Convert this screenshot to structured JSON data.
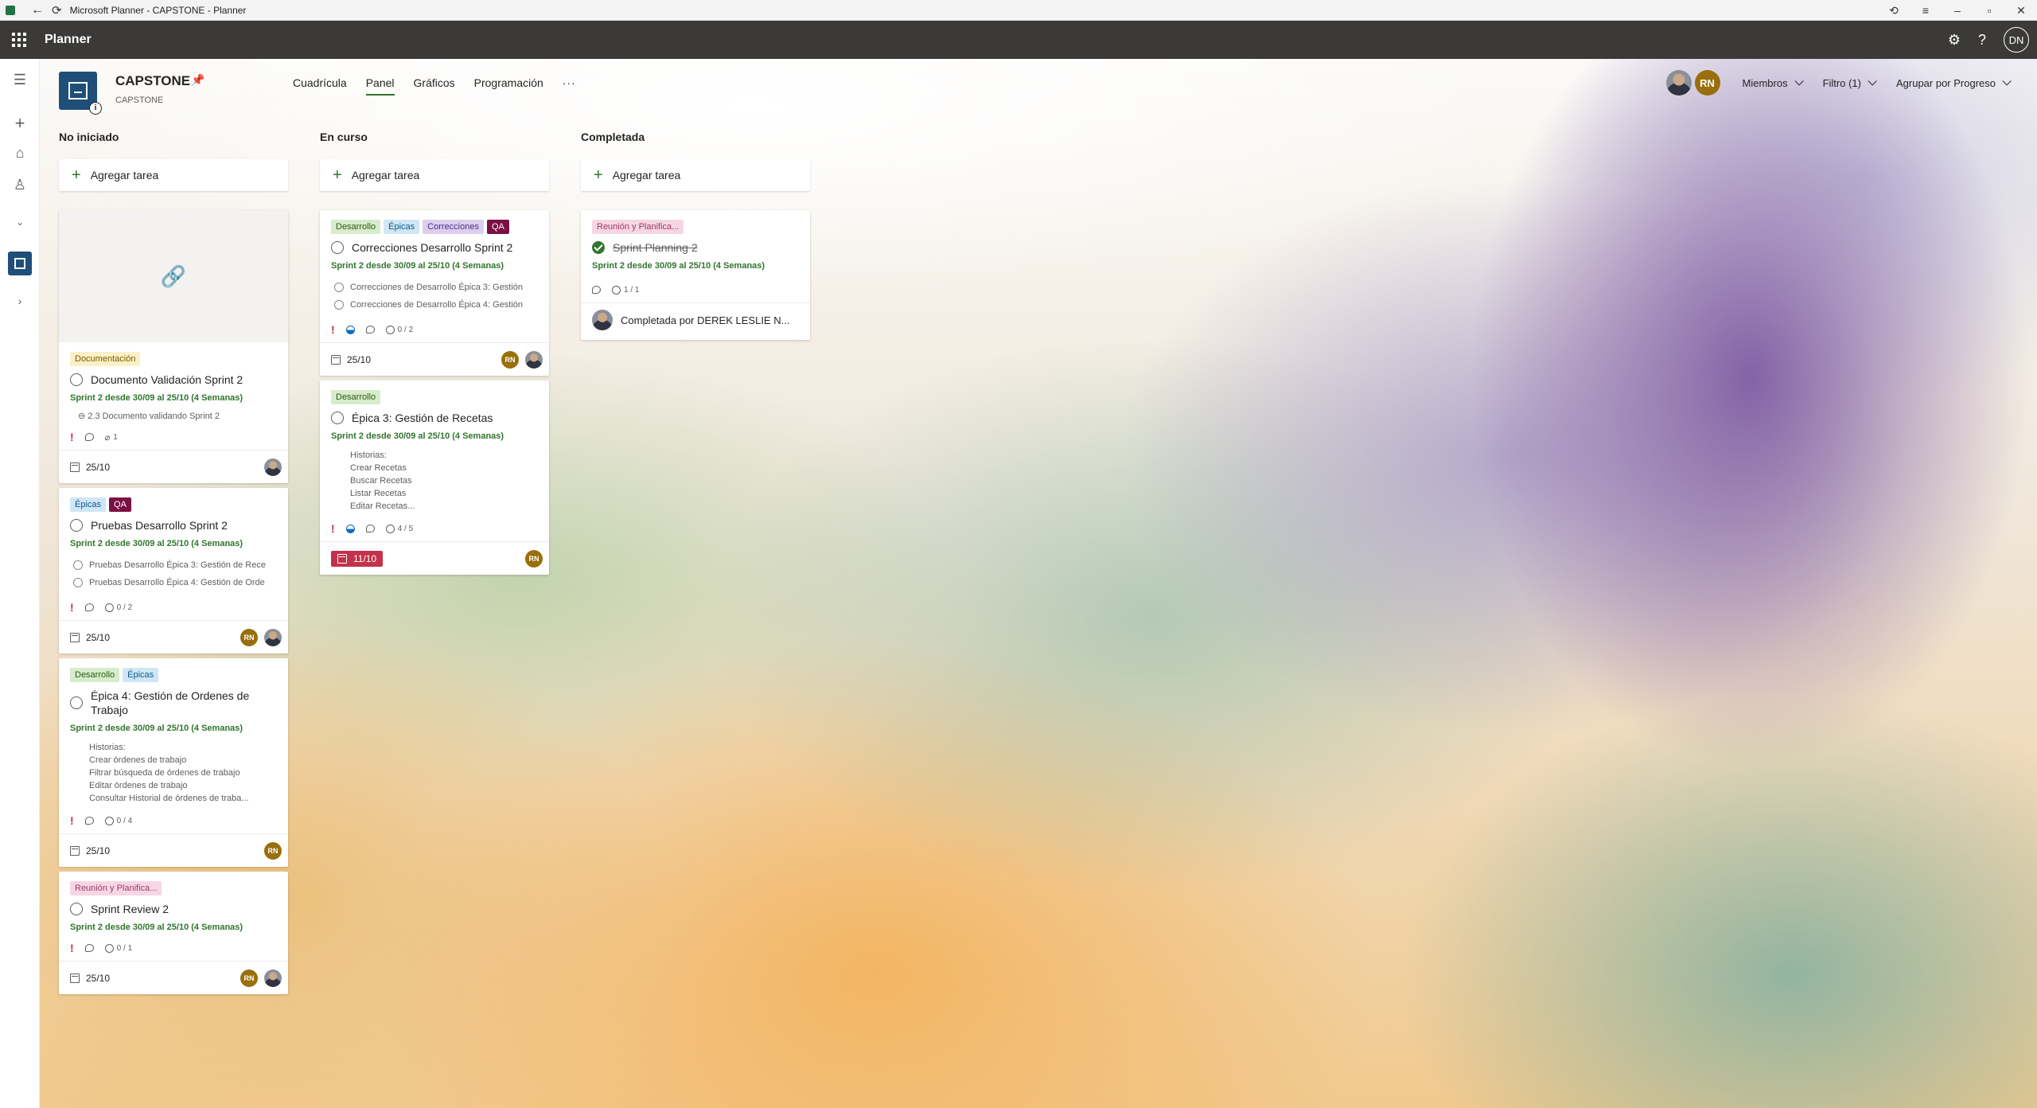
{
  "window": {
    "title": "Microsoft Planner - CAPSTONE - Planner"
  },
  "suite": {
    "app_name": "Planner",
    "user_initials": "DN"
  },
  "plan": {
    "name": "CAPSTONE",
    "group": "CAPSTONE"
  },
  "tabs": [
    {
      "label": "Cuadrícula"
    },
    {
      "label": "Panel"
    },
    {
      "label": "Gráficos"
    },
    {
      "label": "Programación"
    }
  ],
  "tabs_more": "···",
  "header": {
    "member_initials": "RN",
    "members_label": "Miembros",
    "filter_label": "Filtro (1)",
    "group_label": "Agrupar por Progreso"
  },
  "columns": [
    {
      "title": "No iniciado",
      "add_task": "Agregar tarea",
      "cards": [
        {
          "labels": [
            {
              "text": "Documentación"
            }
          ],
          "title": "Documento Validación Sprint 2",
          "description": "Sprint 2 desde 30/09 al 25/10 (4 Semanas)",
          "attachment": "2.3 Documento validando Sprint 2",
          "attachments_count": "1",
          "due": "25/10"
        },
        {
          "labels": [
            {
              "text": "Épicas"
            },
            {
              "text": "QA"
            }
          ],
          "title": "Pruebas Desarrollo Sprint 2",
          "description": "Sprint 2 desde 30/09 al 25/10 (4 Semanas)",
          "checklist": [
            "Pruebas Desarrollo Épica 3: Gestión de Rece",
            "Pruebas Desarrollo Épica 4: Gestión de Orde"
          ],
          "checklist_count": "0 / 2",
          "due": "25/10",
          "assignee_initials": "RN"
        },
        {
          "labels": [
            {
              "text": "Desarrollo"
            },
            {
              "text": "Épicas"
            }
          ],
          "title": "Épica 4: Gestión de Ordenes de Trabajo",
          "description": "Sprint 2 desde 30/09 al 25/10 (4 Semanas)",
          "notes": "Historias:\nCrear órdenes de trabajo\nFiltrar búsqueda de órdenes de trabajo\nEditar órdenes de trabajo\nConsultar Historial de órdenes de traba...",
          "checklist_count": "0 / 4",
          "due": "25/10",
          "assignee_initials": "RN"
        },
        {
          "labels": [
            {
              "text": "Reunión y Planifica..."
            }
          ],
          "title": "Sprint Review 2",
          "description": "Sprint 2 desde 30/09 al 25/10 (4 Semanas)",
          "checklist_count": "0 / 1",
          "due": "25/10",
          "assignee_initials": "RN"
        }
      ]
    },
    {
      "title": "En curso",
      "add_task": "Agregar tarea",
      "cards": [
        {
          "labels": [
            {
              "text": "Desarrollo"
            },
            {
              "text": "Épicas"
            },
            {
              "text": "Correcciones"
            },
            {
              "text": "QA"
            }
          ],
          "title": "Correcciones Desarrollo Sprint 2",
          "description": "Sprint 2 desde 30/09 al 25/10 (4 Semanas)",
          "checklist": [
            "Correcciones de Desarrollo Épica 3: Gestión",
            "Correcciones de Desarrollo Épica 4: Gestión"
          ],
          "checklist_count": "0 / 2",
          "due": "25/10",
          "assignee_initials": "RN"
        },
        {
          "labels": [
            {
              "text": "Desarrollo"
            }
          ],
          "title": "Épica 3: Gestión de Recetas",
          "description": "Sprint 2 desde 30/09 al 25/10 (4 Semanas)",
          "notes": "Historias:\nCrear Recetas\nBuscar Recetas\nListar Recetas\nEditar Recetas...",
          "checklist_count": "4 / 5",
          "due": "11/10",
          "assignee_initials": "RN"
        }
      ]
    },
    {
      "title": "Completada",
      "add_task": "Agregar tarea",
      "cards": [
        {
          "labels": [
            {
              "text": "Reunión y Planifica..."
            }
          ],
          "title": "Sprint Planning 2",
          "description": "Sprint 2 desde 30/09 al 25/10 (4 Semanas)",
          "checklist_count": "1 / 1",
          "completed_by": "Completada por DEREK LESLIE N..."
        }
      ]
    }
  ],
  "colors": {
    "accent_green": "#31752f",
    "suite_bar": "#3b3a39",
    "urgent": "#c4314b",
    "rn_avatar": "#986f0b"
  }
}
